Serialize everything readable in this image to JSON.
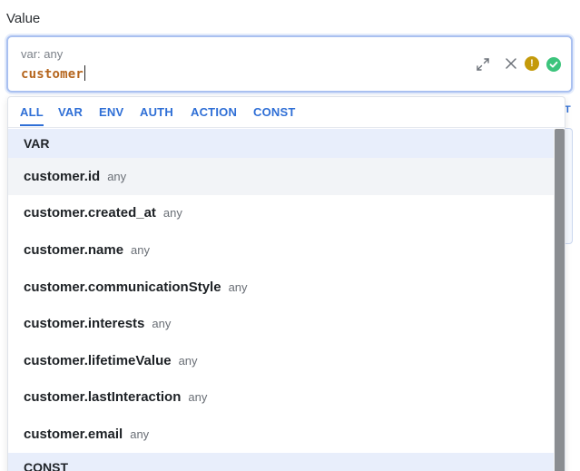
{
  "field": {
    "label": "Value",
    "type_hint": "var: any",
    "value": "customer"
  },
  "background_tab_fragment": "T",
  "dropdown": {
    "tabs": [
      {
        "label": "ALL",
        "active": true
      },
      {
        "label": "VAR",
        "active": false
      },
      {
        "label": "ENV",
        "active": false
      },
      {
        "label": "AUTH",
        "active": false
      },
      {
        "label": "ACTION",
        "active": false
      },
      {
        "label": "CONST",
        "active": false
      }
    ],
    "sections": [
      {
        "title": "VAR",
        "items": [
          {
            "name": "customer.id",
            "type": "any"
          },
          {
            "name": "customer.created_at",
            "type": "any"
          },
          {
            "name": "customer.name",
            "type": "any"
          },
          {
            "name": "customer.communicationStyle",
            "type": "any"
          },
          {
            "name": "customer.interests",
            "type": "any"
          },
          {
            "name": "customer.lifetimeValue",
            "type": "any"
          },
          {
            "name": "customer.lastInteraction",
            "type": "any"
          },
          {
            "name": "customer.email",
            "type": "any"
          }
        ]
      },
      {
        "title": "CONST",
        "items": []
      }
    ]
  },
  "icons": {
    "expand": "expand-icon",
    "clear": "close-icon",
    "warning": "warning-icon",
    "valid": "check-circle-icon"
  },
  "colors": {
    "accent": "#2f6fd6",
    "value_text": "#b5651d",
    "warning": "#c49a0a",
    "valid": "#3cc47c",
    "section_bg": "#e8eefb"
  }
}
